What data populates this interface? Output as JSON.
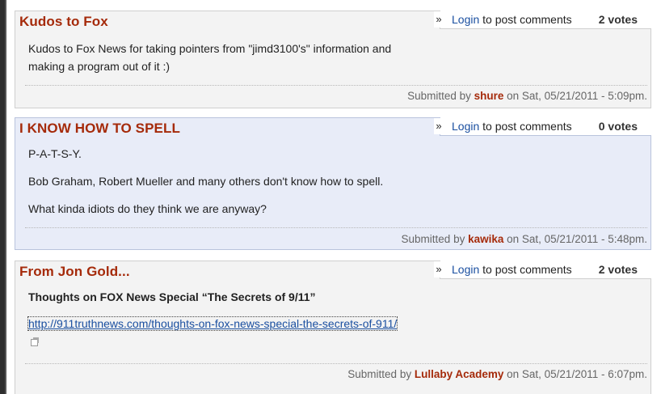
{
  "comments": [
    {
      "title": "Kudos to Fox",
      "links": {
        "raquo": "»",
        "login_label": "Login",
        "post_suffix": " to post comments"
      },
      "votes": "2 votes",
      "body": [
        "Kudos to Fox News for taking pointers from \"jimd3100's\" information and making a program out of it :)"
      ],
      "submitted": {
        "prefix": "Submitted by ",
        "author": "shure",
        "suffix": " on Sat, 05/21/2011 - 5:09pm."
      }
    },
    {
      "title": "I KNOW HOW TO SPELL",
      "links": {
        "raquo": "»",
        "login_label": "Login",
        "post_suffix": " to post comments"
      },
      "votes": "0 votes",
      "body": [
        "P-A-T-S-Y.",
        "Bob Graham, Robert Mueller and many others don't know how to spell.",
        "What kinda idiots do they think we are anyway?"
      ],
      "submitted": {
        "prefix": "Submitted by ",
        "author": "kawika",
        "suffix": " on Sat, 05/21/2011 - 5:48pm."
      }
    },
    {
      "title": "From Jon Gold...",
      "links": {
        "raquo": "»",
        "login_label": "Login",
        "post_suffix": " to post comments"
      },
      "votes": "2 votes",
      "heading": "Thoughts on FOX News Special “The Secrets of 9/11”",
      "link_text": "http://911truthnews.com/thoughts-on-fox-news-special-the-secrets-of-911/",
      "submitted": {
        "prefix": "Submitted by ",
        "author": "Lullaby Academy",
        "suffix": " on Sat, 05/21/2011 - 6:07pm."
      }
    }
  ],
  "icons": {
    "external_link": "external-link-icon",
    "raquo": "raquo-arrow"
  }
}
